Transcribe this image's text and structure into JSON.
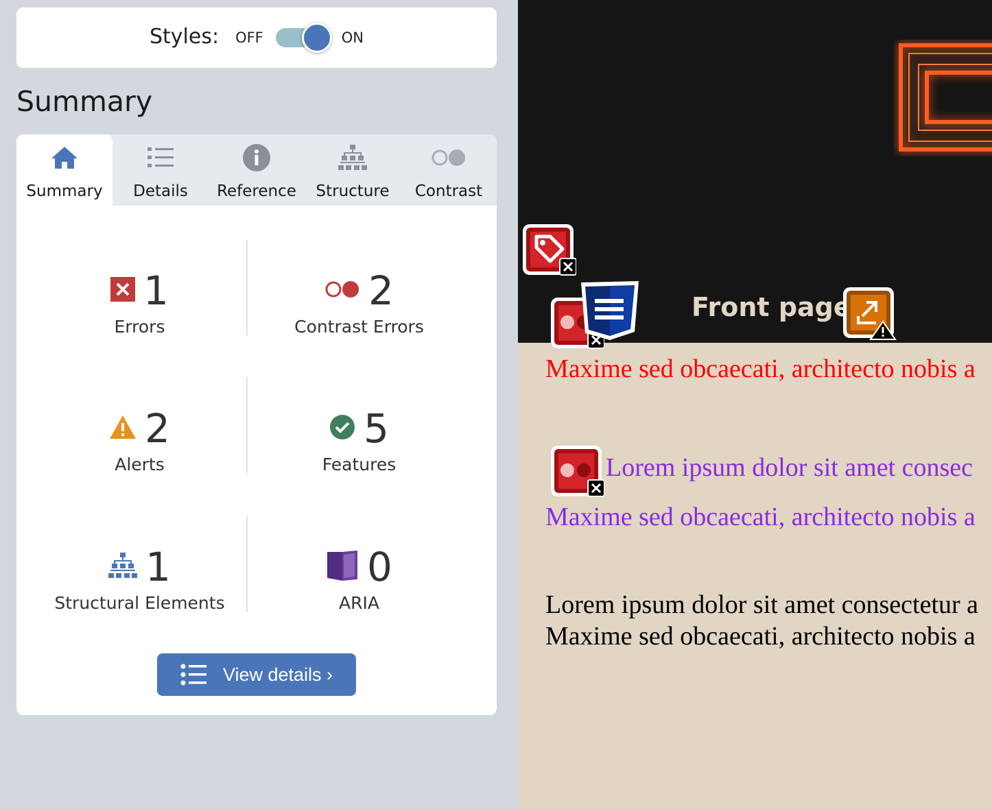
{
  "styles_toggle": {
    "label": "Styles:",
    "off_label": "OFF",
    "on_label": "ON",
    "state": "on"
  },
  "summary_heading": "Summary",
  "tabs": [
    {
      "label": "Summary",
      "icon": "home-icon",
      "active": true
    },
    {
      "label": "Details",
      "icon": "list-icon",
      "active": false
    },
    {
      "label": "Reference",
      "icon": "info-icon",
      "active": false
    },
    {
      "label": "Structure",
      "icon": "hierarchy-icon",
      "active": false
    },
    {
      "label": "Contrast",
      "icon": "contrast-icon",
      "active": false
    }
  ],
  "stats": {
    "errors": {
      "count": "1",
      "label": "Errors",
      "icon": "error-x-icon"
    },
    "contrast_errors": {
      "count": "2",
      "label": "Contrast Errors",
      "icon": "contrast-error-icon"
    },
    "alerts": {
      "count": "2",
      "label": "Alerts",
      "icon": "alert-triangle-icon"
    },
    "features": {
      "count": "5",
      "label": "Features",
      "icon": "check-circle-icon"
    },
    "structural": {
      "count": "1",
      "label": "Structural Elements",
      "icon": "hierarchy-icon"
    },
    "aria": {
      "count": "0",
      "label": "ARIA",
      "icon": "aria-cube-icon"
    }
  },
  "view_details_button": "View details ›",
  "preview": {
    "front_page": "Front page",
    "lines": [
      "Maxime sed obcaecati, architecto nobis a",
      "Lorem ipsum dolor sit amet consec",
      "Maxime sed obcaecati, architecto nobis a",
      "Lorem ipsum dolor sit amet consectetur a",
      "Maxime sed obcaecati, architecto nobis a"
    ]
  },
  "colors": {
    "accent": "#4a76b9",
    "error": "#c23b3b",
    "alert": "#e8921c",
    "feature": "#3f7e5e",
    "aria": "#4f2d7f",
    "preview_red": "#ff0000",
    "preview_purple": "#8a2be2",
    "preview_bg": "#e1d5c3",
    "header_bg": "#151515"
  }
}
